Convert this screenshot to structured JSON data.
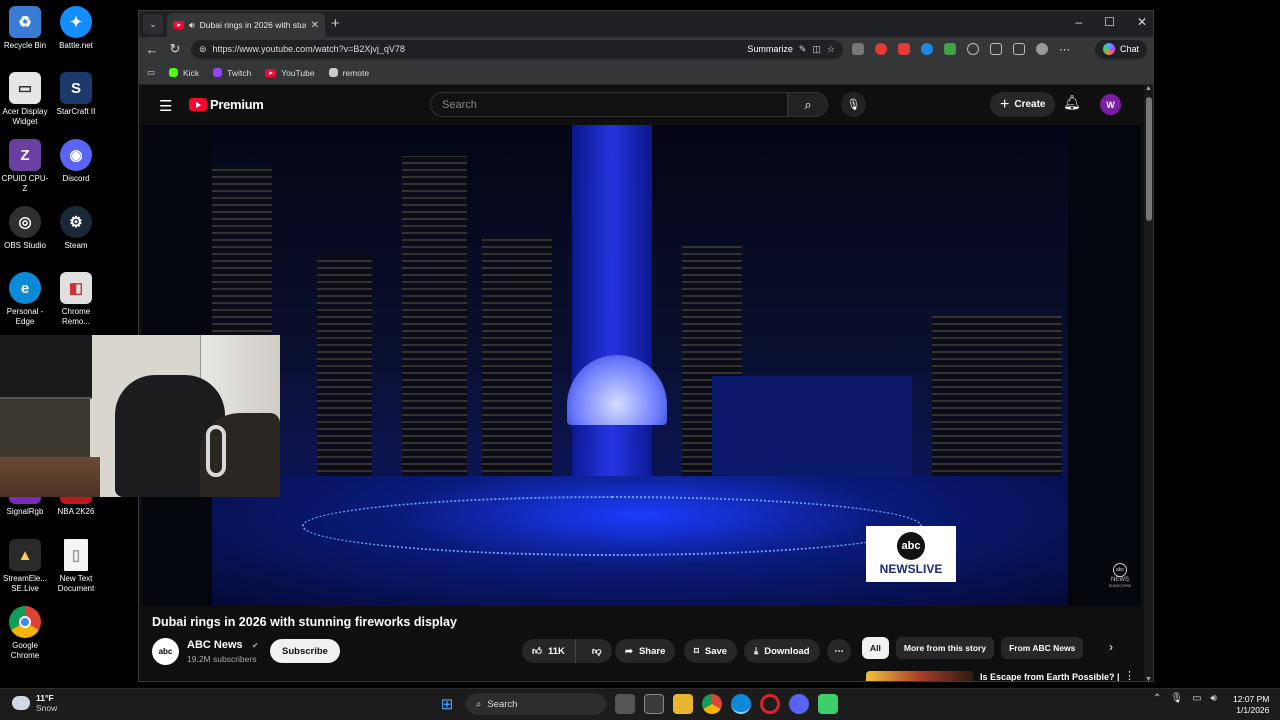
{
  "desktop": {
    "icons": [
      {
        "label": "Recycle Bin",
        "color": "#3a7bd5",
        "glyph": "♻"
      },
      {
        "label": "Battle.net",
        "color": "#148eff",
        "glyph": "✦"
      },
      {
        "label": "Acer Display Widget",
        "color": "#e6e6e6",
        "glyph": "▭"
      },
      {
        "label": "StarCraft II",
        "color": "#1b3a6b",
        "glyph": "S"
      },
      {
        "label": "CPUID CPU-Z",
        "color": "#6b3fa0",
        "glyph": "Z"
      },
      {
        "label": "Discord",
        "color": "#5865f2",
        "glyph": "◉"
      },
      {
        "label": "OBS Studio",
        "color": "#302e31",
        "glyph": "◎"
      },
      {
        "label": "Steam",
        "color": "#1b2838",
        "glyph": "⚙"
      },
      {
        "label": "Personal - Edge",
        "color": "#0c8ad8",
        "glyph": "e"
      },
      {
        "label": "Chrome Remo...",
        "color": "#e0e0e0",
        "glyph": "◧"
      },
      {
        "label": "SignalRgb",
        "color": "#7a2bbf",
        "glyph": "◆"
      },
      {
        "label": "NBA 2K26",
        "color": "#c4161c",
        "glyph": "N"
      },
      {
        "label": "StreamEle... SE.Live",
        "color": "#2a2a2a",
        "glyph": "▲"
      },
      {
        "label": "New Text Document",
        "color": "#f4f4f4",
        "glyph": "▯"
      },
      {
        "label": "Google Chrome",
        "color": "#ffffff",
        "glyph": "◉"
      }
    ]
  },
  "browser": {
    "tab": {
      "title": "Dubai rings in 2026 with stunning fireworks display",
      "close": "✕"
    },
    "new_tab": "+",
    "window_controls": {
      "minimize": "–",
      "maximize": "☐",
      "close": "✕"
    },
    "address": {
      "url": "https://www.youtube.com/watch?v=B2Xjvj_qV78",
      "summarize": "Summarize"
    },
    "chat_label": "Chat",
    "favorites": [
      {
        "label": "Kick",
        "color": "#53fc18"
      },
      {
        "label": "Twitch",
        "color": "#9146ff"
      },
      {
        "label": "YouTube",
        "color": "#ff0033"
      },
      {
        "label": "remote",
        "color": "#cccccc"
      }
    ],
    "extension_colors": [
      "#888888",
      "#e53935",
      "#e53935",
      "#1e88e5",
      "#43a047",
      "#bbbbbb",
      "#bbbbbb",
      "#bbbbbb",
      "#bbbbbb",
      "#999999"
    ]
  },
  "youtube": {
    "logo_text": "Premium",
    "search_placeholder": "Search",
    "create_label": "Create",
    "avatar_letter": "W",
    "video": {
      "title": "Dubai rings in 2026 with stunning fireworks display",
      "badge_abc": "abc",
      "badge_news": "NEWSLIVE",
      "watermark_abc": "abc",
      "watermark_news": "NEWS",
      "watermark_sub": "SUBSCRIBE"
    },
    "channel": {
      "name": "ABC News",
      "verified": "✔",
      "subscribers": "19.2M subscribers",
      "avatar_text": "abc",
      "subscribe_label": "Subscribe"
    },
    "actions": {
      "likes": "11K",
      "share": "Share",
      "save": "Save",
      "download": "Download",
      "more": "⋯"
    },
    "chips": [
      "All",
      "More from this story",
      "From ABC News"
    ],
    "recommendation": {
      "title": "Is Escape from Earth Possible? | One Strange Rock Ft. Will Smit"
    }
  },
  "taskbar": {
    "weather_temp": "11°F",
    "weather_desc": "Snow",
    "search_label": "Search",
    "time": "12:07 PM",
    "date": "1/1/2026"
  }
}
